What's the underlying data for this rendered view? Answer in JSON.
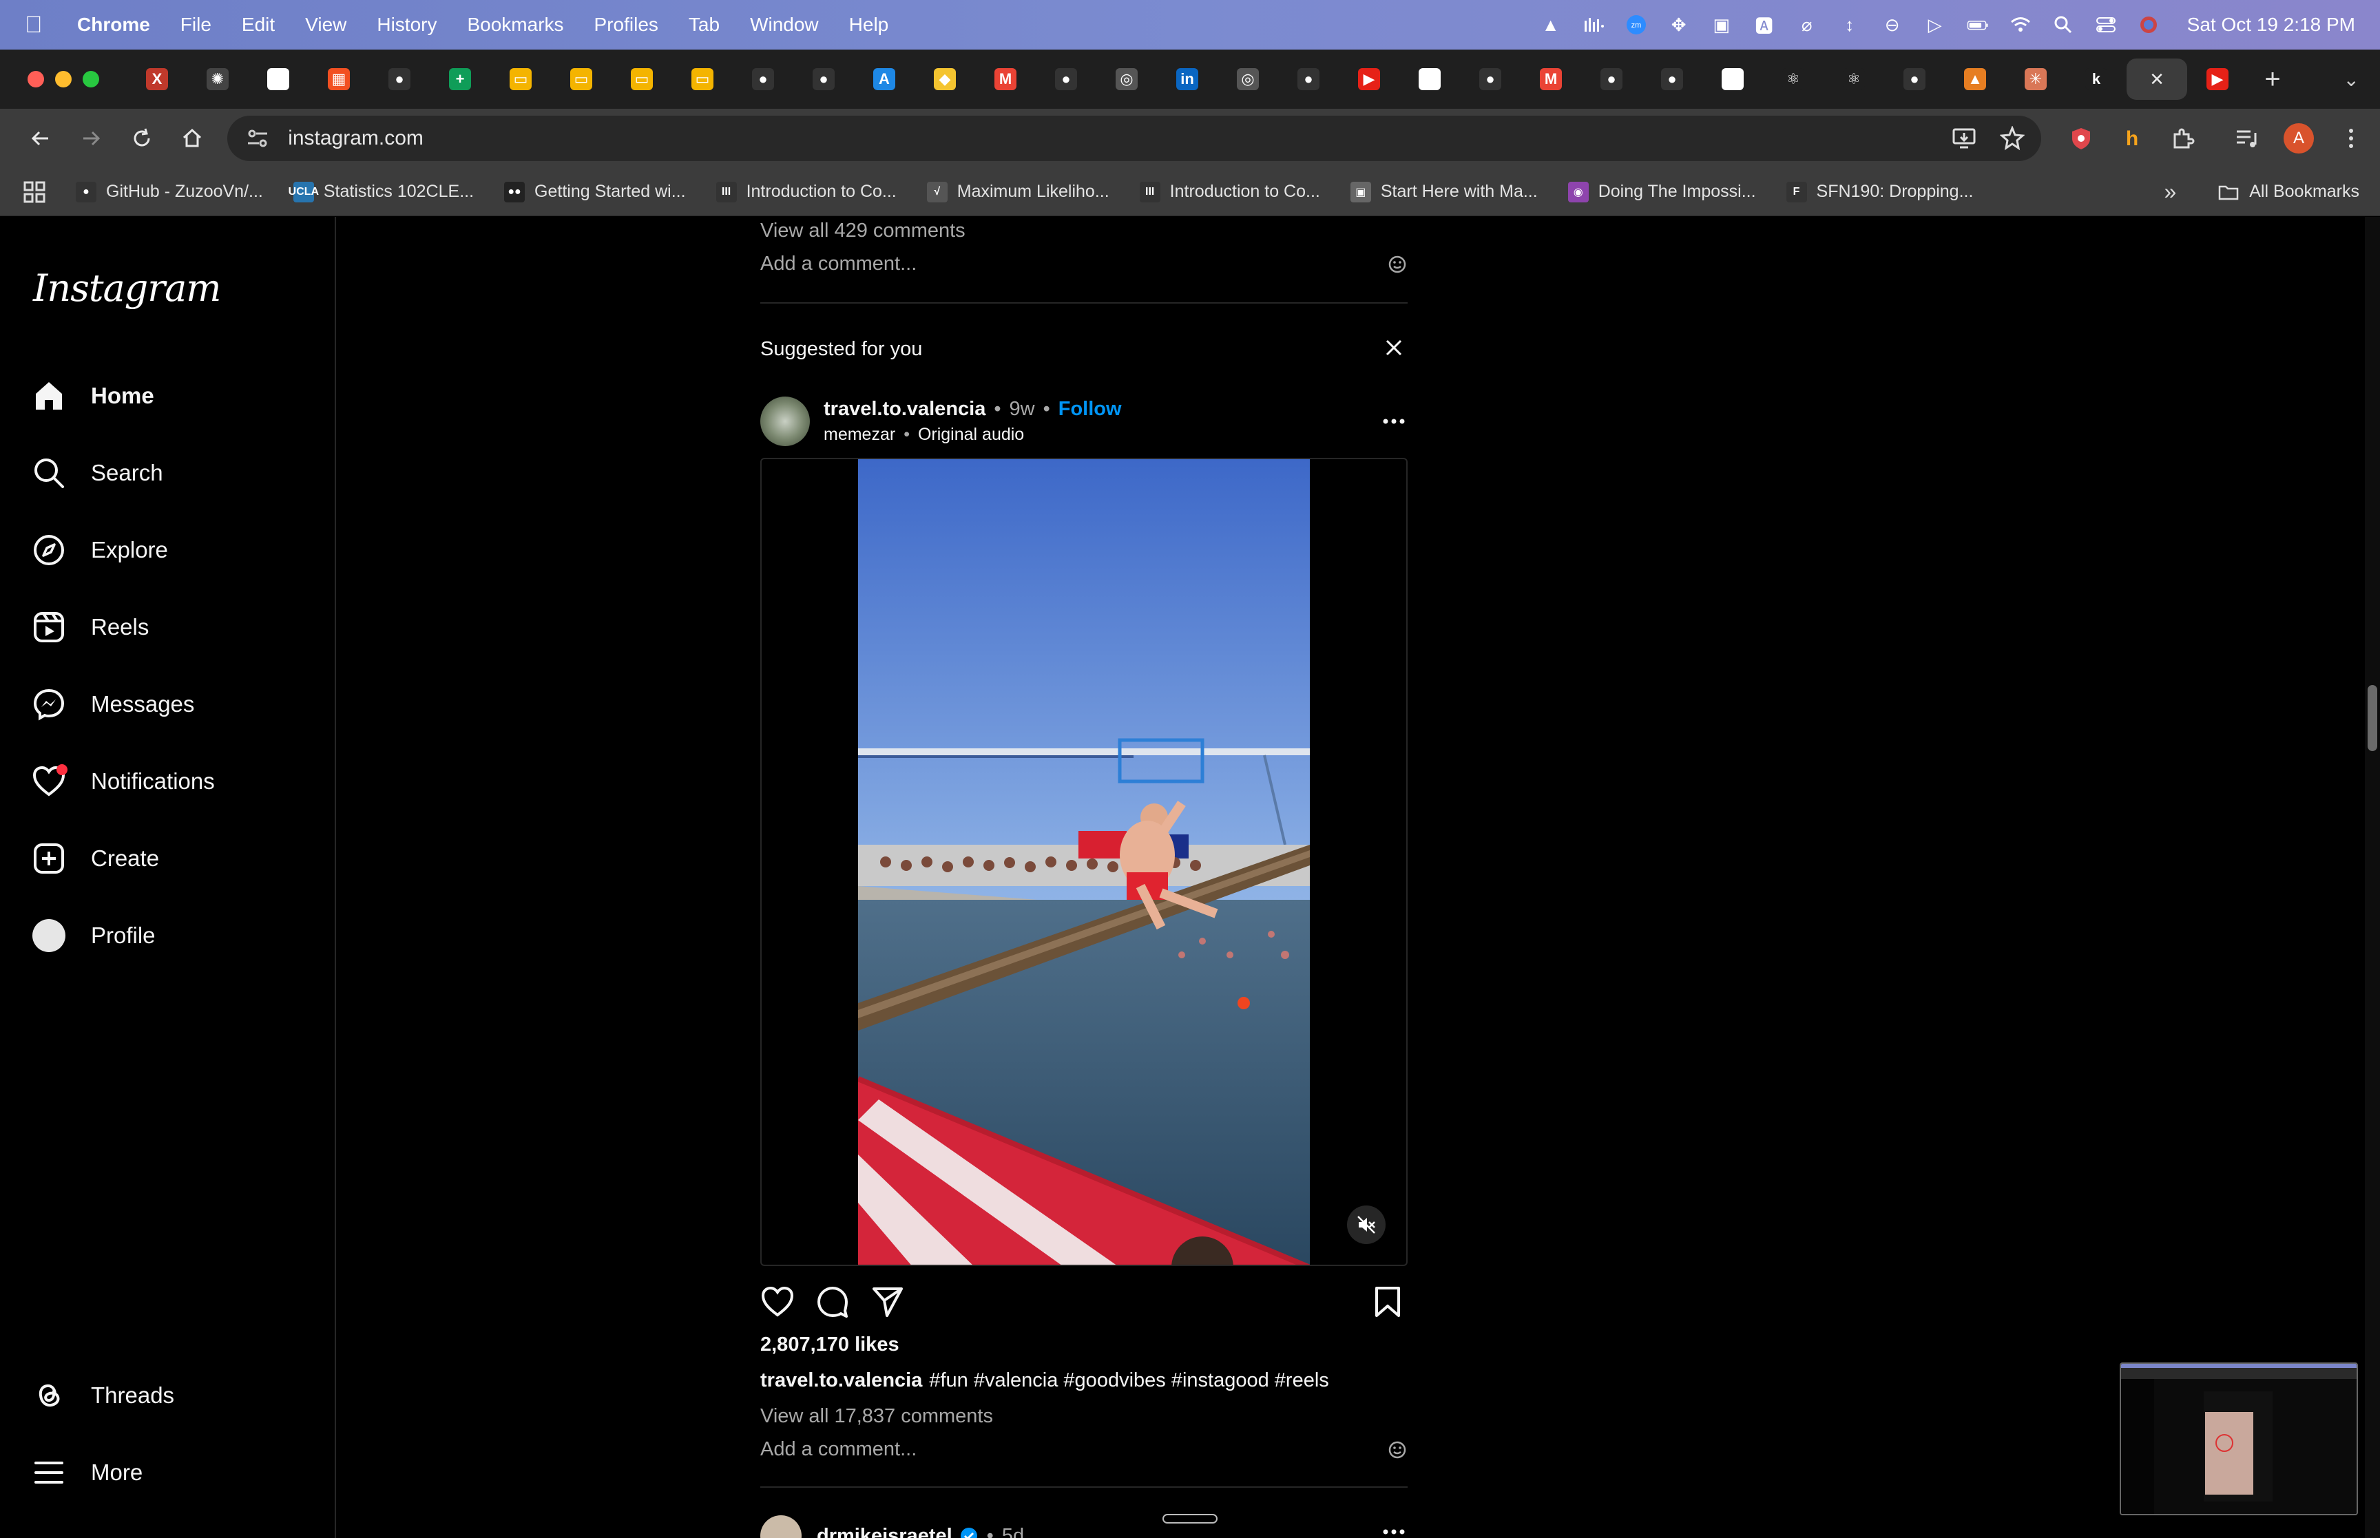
{
  "menubar": {
    "app_name": "Chrome",
    "items": [
      "File",
      "Edit",
      "View",
      "History",
      "Bookmarks",
      "Profiles",
      "Tab",
      "Window",
      "Help"
    ],
    "clock": "Sat Oct 19  2:18 PM"
  },
  "tabs": {
    "favicons": [
      {
        "icon": "x-logo-icon",
        "glyph": "X",
        "color": "#c0392b"
      },
      {
        "icon": "gear-bug-icon",
        "glyph": "✺",
        "color": "#444444"
      },
      {
        "icon": "google-icon",
        "glyph": "G",
        "color": "#ffffff"
      },
      {
        "icon": "microsoft-icon",
        "glyph": "▦",
        "color": "#f25022"
      },
      {
        "icon": "github-icon",
        "glyph": "●",
        "color": "#333333"
      },
      {
        "icon": "sheets-icon",
        "glyph": "+",
        "color": "#0f9d58"
      },
      {
        "icon": "slides-icon",
        "glyph": "▭",
        "color": "#f4b400"
      },
      {
        "icon": "slides-icon",
        "glyph": "▭",
        "color": "#f4b400"
      },
      {
        "icon": "slides-icon",
        "glyph": "▭",
        "color": "#f4b400"
      },
      {
        "icon": "slides-icon",
        "glyph": "▭",
        "color": "#f4b400"
      },
      {
        "icon": "github-icon",
        "glyph": "●",
        "color": "#333333"
      },
      {
        "icon": "github-icon",
        "glyph": "●",
        "color": "#333333"
      },
      {
        "icon": "app-store-icon",
        "glyph": "A",
        "color": "#1e88e5"
      },
      {
        "icon": "badge-icon",
        "glyph": "◆",
        "color": "#f4c430"
      },
      {
        "icon": "gmail-icon",
        "glyph": "M",
        "color": "#ea4335"
      },
      {
        "icon": "github-icon",
        "glyph": "●",
        "color": "#333333"
      },
      {
        "icon": "chrome-icon",
        "glyph": "◎",
        "color": "#555555"
      },
      {
        "icon": "linkedin-icon",
        "glyph": "in",
        "color": "#0a66c2"
      },
      {
        "icon": "chrome-icon",
        "glyph": "◎",
        "color": "#555555"
      },
      {
        "icon": "github-icon",
        "glyph": "●",
        "color": "#333333"
      },
      {
        "icon": "youtube-icon",
        "glyph": "▶",
        "color": "#e62117"
      },
      {
        "icon": "medium-icon",
        "glyph": "●●",
        "color": "#ffffff"
      },
      {
        "icon": "github-icon",
        "glyph": "●",
        "color": "#333333"
      },
      {
        "icon": "gmail-icon",
        "glyph": "M",
        "color": "#ea4335"
      },
      {
        "icon": "github-icon",
        "glyph": "●",
        "color": "#333333"
      },
      {
        "icon": "github-icon",
        "glyph": "●",
        "color": "#333333"
      },
      {
        "icon": "google-icon",
        "glyph": "G",
        "color": "#ffffff"
      },
      {
        "icon": "react-icon",
        "glyph": "⚛",
        "color": "#1f1f1f"
      },
      {
        "icon": "react-icon",
        "glyph": "⚛",
        "color": "#1f1f1f"
      },
      {
        "icon": "github-icon",
        "glyph": "●",
        "color": "#333333"
      },
      {
        "icon": "chart-icon",
        "glyph": "▲",
        "color": "#e67e22"
      },
      {
        "icon": "claude-icon",
        "glyph": "✳",
        "color": "#d97757"
      },
      {
        "icon": "k-icon",
        "glyph": "k",
        "color": "#1f1f1f"
      }
    ],
    "active_close": "×",
    "trailing": {
      "icon": "youtube-icon",
      "glyph": "▶",
      "color": "#e62117"
    },
    "new_tab": "+",
    "tab_menu": "⌄"
  },
  "toolbar": {
    "url": "instagram.com",
    "avatar_letter": "A"
  },
  "bookmarks": {
    "items": [
      {
        "label": "GitHub - ZuzooVn/...",
        "glyph": "●",
        "color": "#333333"
      },
      {
        "label": "Statistics 102CLE...",
        "glyph": "UCLA",
        "color": "#2774ae"
      },
      {
        "label": "Getting Started wi...",
        "glyph": "●●",
        "color": "#222222"
      },
      {
        "label": "Introduction to Co...",
        "glyph": "III",
        "color": "#333333"
      },
      {
        "label": "Maximum Likeliho...",
        "glyph": "√",
        "color": "#555555"
      },
      {
        "label": "Introduction to Co...",
        "glyph": "III",
        "color": "#333333"
      },
      {
        "label": "Start Here with Ma...",
        "glyph": "▣",
        "color": "#666666"
      },
      {
        "label": "Doing The Impossi...",
        "glyph": "◉",
        "color": "#8e44ad"
      },
      {
        "label": "SFN190: Dropping...",
        "glyph": "F",
        "color": "#333333"
      }
    ],
    "more": "»",
    "all_bookmarks": "All Bookmarks"
  },
  "sidebar": {
    "logo": "Instagram",
    "items": [
      {
        "label": "Home",
        "icon": "home-icon"
      },
      {
        "label": "Search",
        "icon": "search-icon"
      },
      {
        "label": "Explore",
        "icon": "compass-icon"
      },
      {
        "label": "Reels",
        "icon": "reels-icon"
      },
      {
        "label": "Messages",
        "icon": "messenger-icon"
      },
      {
        "label": "Notifications",
        "icon": "heart-icon"
      },
      {
        "label": "Create",
        "icon": "plus-square-icon"
      },
      {
        "label": "Profile",
        "icon": "profile-avatar"
      }
    ],
    "bottom": [
      {
        "label": "Threads",
        "icon": "threads-icon"
      },
      {
        "label": "More",
        "icon": "hamburger-icon"
      }
    ]
  },
  "feed": {
    "prev_post": {
      "view_all": "View all 429 comments",
      "add_comment": "Add a comment..."
    },
    "suggested_label": "Suggested for you",
    "post": {
      "username": "travel.to.valencia",
      "separator": "•",
      "time": "9w",
      "follow": "Follow",
      "audio_user": "memezar",
      "audio_title": "Original audio",
      "likes": "2,807,170 likes",
      "caption_user": "travel.to.valencia",
      "caption_text": "#fun #valencia #goodvibes #instagood #reels",
      "view_all": "View all 17,837 comments",
      "add_comment": "Add a comment..."
    },
    "next_post": {
      "username": "drmikeisraetel",
      "time": "5d"
    }
  }
}
